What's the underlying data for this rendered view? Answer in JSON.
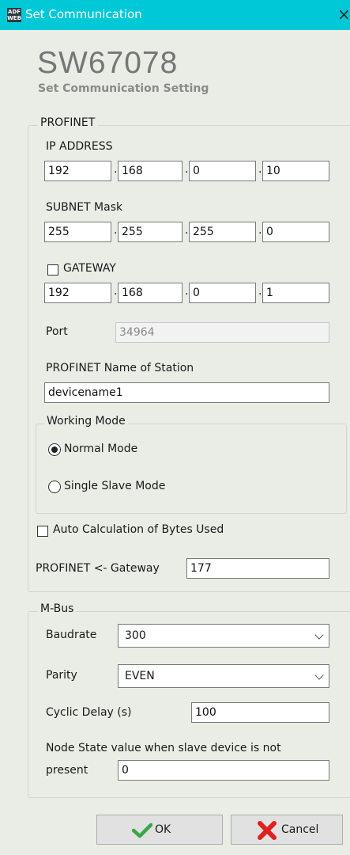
{
  "window": {
    "title": "Set Communication",
    "close_glyph": "×",
    "app_icon_text": "ADF WEB"
  },
  "header": {
    "model": "SW67078",
    "subtitle": "Set Communication Setting"
  },
  "profinet": {
    "legend": "PROFINET",
    "ip_label": "IP ADDRESS",
    "ip": [
      "192",
      "168",
      "0",
      "10"
    ],
    "subnet_label": "SUBNET Mask",
    "subnet": [
      "255",
      "255",
      "255",
      "0"
    ],
    "gateway_label": "GATEWAY",
    "gateway_checked": false,
    "gateway": [
      "192",
      "168",
      "0",
      "1"
    ],
    "port_label": "Port",
    "port_value": "34964",
    "station_label": "PROFINET Name of Station",
    "station_value": "devicename1",
    "working_mode": {
      "legend": "Working Mode",
      "options": [
        "Normal Mode",
        "Single Slave Mode"
      ],
      "selected": "Normal Mode"
    },
    "auto_calc_label": "Auto Calculation of Bytes Used",
    "auto_calc_checked": false,
    "to_gateway_label": "PROFINET <- Gateway",
    "to_gateway_value": "177"
  },
  "mbus": {
    "legend": "M-Bus",
    "baudrate_label": "Baudrate",
    "baudrate_value": "300",
    "parity_label": "Parity",
    "parity_value": "EVEN",
    "cyclic_label": "Cyclic Delay (s)",
    "cyclic_value": "100",
    "node_state_label_line1": "Node State value when slave device is not",
    "node_state_label_line2": "present",
    "node_state_value": "0"
  },
  "buttons": {
    "ok": "OK",
    "cancel": "Cancel"
  },
  "colors": {
    "titlebar": "#00c8d7",
    "check_green": "#3aa64a",
    "cancel_red": "#e02020"
  }
}
